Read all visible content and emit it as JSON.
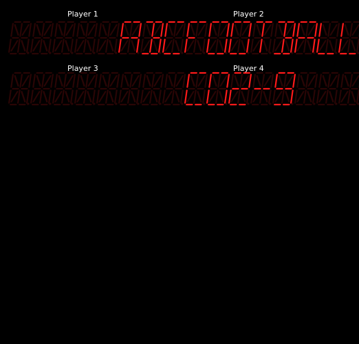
{
  "scoreboard": {
    "colors": {
      "background": "#000000",
      "label": "#ffffff",
      "segment_lit": "#ff1a1a",
      "segment_unlit": "#2a0505"
    },
    "players": [
      {
        "label": "Player 1",
        "display": "ABC"
      },
      {
        "label": "Player 2",
        "display": "FOOTBALL"
      },
      {
        "label": "Player 3",
        "display": ""
      },
      {
        "label": "Player 4",
        "display": "C02-9"
      }
    ]
  }
}
